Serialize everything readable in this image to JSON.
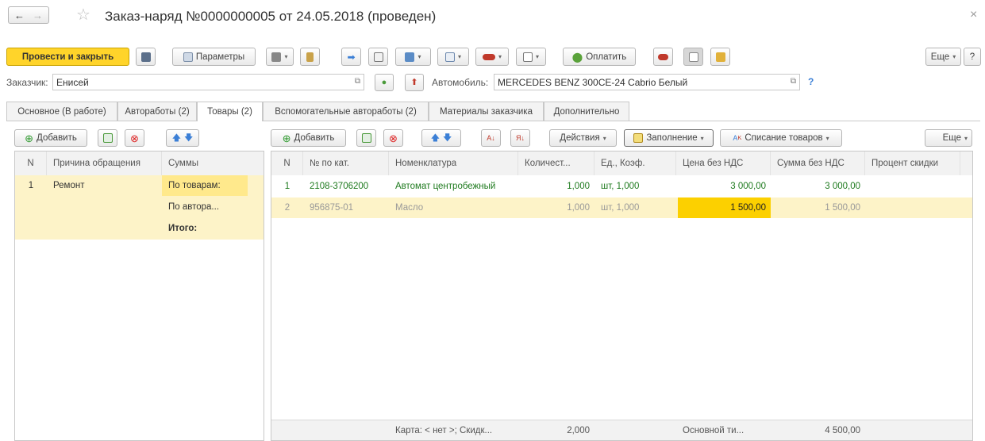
{
  "window": {
    "title": "Заказ-наряд №0000000005 от 24.05.2018 (проведен)",
    "close": "×",
    "back": "←",
    "forward": "→",
    "star": "☆"
  },
  "toolbar": {
    "post_close": "Провести и закрыть",
    "params": "Параметры",
    "pay": "Оплатить",
    "more": "Еще",
    "help": "?"
  },
  "header": {
    "customer_label": "Заказчик:",
    "customer_value": "Енисей",
    "car_label": "Автомобиль:",
    "car_value": "MERCEDES BENZ 300CE-24 Cabrio Белый",
    "help": "?"
  },
  "tabs": [
    "Основное (В работе)",
    "Автоработы (2)",
    "Товары (2)",
    "Вспомогательные автоработы (2)",
    "Материалы заказчика",
    "Дополнительно"
  ],
  "left_panel": {
    "add": "Добавить",
    "columns": [
      "N",
      "Причина обращения",
      "Суммы"
    ],
    "rows": [
      {
        "n": "1",
        "reason": "Ремонт",
        "sums": [
          "По товарам:",
          "По автора...",
          "Итого:"
        ]
      }
    ]
  },
  "right_panel": {
    "add": "Добавить",
    "actions": "Действия",
    "fill": "Заполнение",
    "write_off": "Списание товаров",
    "more": "Еще",
    "columns": [
      "N",
      "№ по кат.",
      "Номенклатура",
      "Количест...",
      "Ед., Коэф.",
      "Цена без НДС",
      "Сумма без НДС",
      "Процент скидки"
    ],
    "rows": [
      {
        "n": "1",
        "cat": "2108-3706200",
        "name": "Автомат центробежный",
        "qty": "1,000",
        "unit": "шт, 1,000",
        "price": "3 000,00",
        "sum": "3 000,00",
        "disc": ""
      },
      {
        "n": "2",
        "cat": "956875-01",
        "name": "Масло",
        "qty": "1,000",
        "unit": "шт, 1,000",
        "price": "1 500,00",
        "sum": "1 500,00",
        "disc": ""
      }
    ],
    "footer": {
      "card": "Карта: < нет >; Скидк...",
      "qty": "2,000",
      "price_type": "Основной ти...",
      "sum": "4 500,00"
    }
  },
  "colors": {
    "accent": "#ffd42a",
    "selected_row": "#fdf3c8",
    "active_cell": "#fcd000",
    "green_text": "#1e7a1e"
  }
}
